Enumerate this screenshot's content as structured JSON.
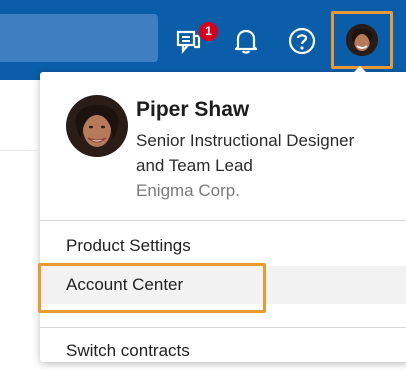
{
  "header": {
    "notification_count": "1",
    "icons": [
      "messages-icon",
      "bell-icon",
      "help-icon",
      "avatar"
    ]
  },
  "profile": {
    "name": "Piper Shaw",
    "title": "Senior Instructional Designer and Team Lead",
    "company": "Enigma Corp."
  },
  "menu": {
    "items": [
      {
        "label": "Product Settings"
      },
      {
        "label": "Account Center"
      },
      {
        "label": "Switch contracts"
      }
    ]
  },
  "colors": {
    "header_bg": "#0a5da8",
    "highlight_border": "#e89b35",
    "badge": "#d9001b"
  }
}
